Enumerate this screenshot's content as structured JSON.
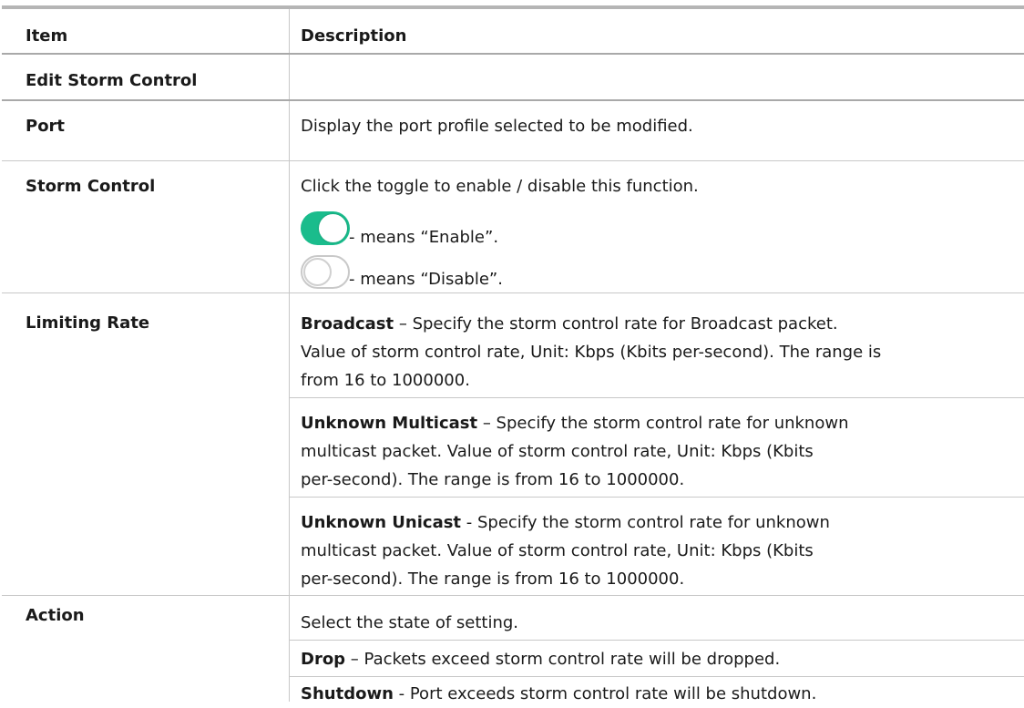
{
  "table": {
    "header": {
      "item": "Item",
      "description": "Description"
    },
    "section": "Edit Storm Control",
    "rows": [
      {
        "item": "Port",
        "desc": [
          "Display the port profile selected to be modified."
        ]
      },
      {
        "item": "Storm Control",
        "desc": [
          "Click the toggle to enable / disable this function.",
          "- means “Enable”.",
          "- means “Disable”."
        ]
      },
      {
        "item": "Limiting Rate",
        "desc": [
          {
            "term": "Broadcast",
            "lines": [
              " – Specify the storm control rate for Broadcast packet.",
              "Value of storm control rate, Unit: Kbps (Kbits per-second). The range is",
              "from 16 to 1000000."
            ]
          },
          {
            "term": "Unknown Multicast",
            "lines": [
              " – Specify the storm control rate for unknown",
              "multicast packet. Value of storm control rate, Unit: Kbps (Kbits",
              "per-second). The range is from 16 to 1000000."
            ]
          },
          {
            "term": "Unknown Unicast",
            "lines": [
              " - Specify the storm control rate for unknown",
              "multicast packet. Value of storm control rate, Unit: Kbps (Kbits",
              "per-second). The range is from 16 to 1000000."
            ]
          }
        ]
      },
      {
        "item": "Action",
        "desc": [
          "Select the state of setting.",
          {
            "term": "Drop",
            "lines": [
              " – Packets exceed storm control rate will be dropped."
            ]
          },
          {
            "term": "Shutdown",
            "lines": [
              " - Port exceeds storm control rate will be shutdown."
            ]
          }
        ]
      }
    ]
  },
  "toggles": {
    "enable_color": "#1abc8c",
    "disable_color": "#ffffff",
    "border_color": "#c9c9c9"
  }
}
